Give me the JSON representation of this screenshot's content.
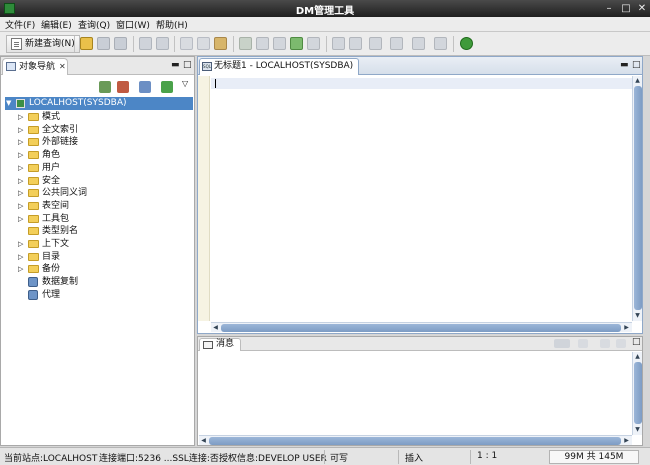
{
  "window": {
    "title": "DM管理工具"
  },
  "menu": [
    "文件(F)",
    "编辑(E)",
    "查询(Q)",
    "窗口(W)",
    "帮助(H)"
  ],
  "toolbar": {
    "new_query_label": "新建查询(N)"
  },
  "nav": {
    "tab_label": "对象导航",
    "root_label": "LOCALHOST(SYSDBA)",
    "items": [
      {
        "label": "模式",
        "type": "folder",
        "expandable": true
      },
      {
        "label": "全文索引",
        "type": "folder",
        "expandable": true
      },
      {
        "label": "外部链接",
        "type": "folder",
        "expandable": true
      },
      {
        "label": "角色",
        "type": "folder",
        "expandable": true
      },
      {
        "label": "用户",
        "type": "folder",
        "expandable": true
      },
      {
        "label": "安全",
        "type": "folder",
        "expandable": true
      },
      {
        "label": "公共同义词",
        "type": "folder",
        "expandable": true
      },
      {
        "label": "表空间",
        "type": "folder",
        "expandable": true
      },
      {
        "label": "工具包",
        "type": "folder",
        "expandable": true
      },
      {
        "label": "类型别名",
        "type": "folder",
        "expandable": false
      },
      {
        "label": "上下文",
        "type": "folder",
        "expandable": true
      },
      {
        "label": "目录",
        "type": "folder",
        "expandable": true
      },
      {
        "label": "备份",
        "type": "folder",
        "expandable": true
      },
      {
        "label": "数据复制",
        "type": "item",
        "expandable": false
      },
      {
        "label": "代理",
        "type": "item",
        "expandable": false
      }
    ]
  },
  "editor": {
    "tab_label": "无标题1 - LOCALHOST(SYSDBA)",
    "tab_icon_text": "SQL"
  },
  "messages": {
    "tab_label": "消息"
  },
  "status": {
    "site": "当前站点:LOCALHOST",
    "port": "连接端口:5236 ...SSL连接:否",
    "auth": "授权信息:DEVELOP USER",
    "mode": "可写",
    "insert": "插入",
    "position": "1 : 1",
    "memory": "99M 共 145M"
  }
}
